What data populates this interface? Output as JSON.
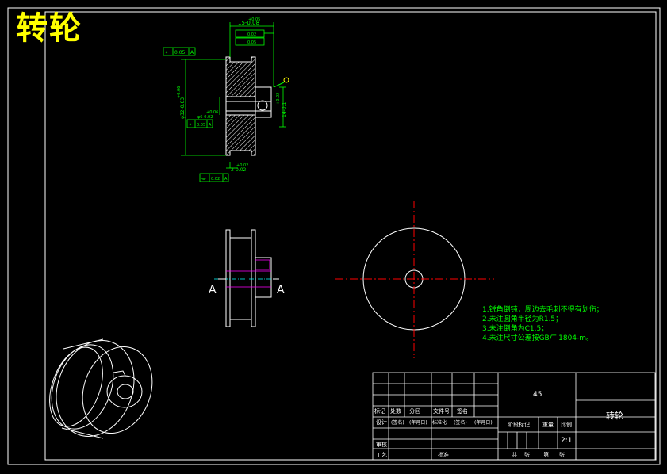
{
  "title": "转轮",
  "colors": {
    "background": "#000000",
    "outline": "#ffffff",
    "title": "#ffff00",
    "dimension": "#00ff00",
    "centerline": "#ff0000",
    "hidden": "#ff00ff",
    "notes": "#00ff00"
  },
  "dimensions": {
    "top_width": "15-0.08",
    "top_width_tol": "+0.05",
    "flatness_tol": "0.05",
    "flatness_datum": "A",
    "diameter": "φ32-0.03",
    "diameter_tol": "+0.06",
    "bore": "φ6-0.02",
    "bore_tol": "+0.06",
    "bore_concentricity": "0.05",
    "bore_datum": "A",
    "height": "14-0.1",
    "height_tol": "+0.02",
    "bottom_small": "2-0.02",
    "bottom_small_tol": "+0.02",
    "symmetry_tol": "0.02",
    "symmetry_datum": "A",
    "perpendicularity": "0.02",
    "parallelism": "0.05"
  },
  "section_label": "A",
  "notes": [
    "1.锐角倒钝，周边去毛刺不得有划伤；",
    "2.未注圆角半径为R1.5；",
    "3.未注倒角为C1.5；",
    "4.未注尺寸公差按GB/T 1804-m。"
  ],
  "title_block": {
    "material": "45",
    "part_name": "转轮",
    "scale": "2:1",
    "labels": {
      "mark": "标记",
      "count": "处数",
      "zone": "分区",
      "doc_no": "文件号",
      "sign": "签名",
      "design": "设计",
      "standardize": "标准化",
      "stage_mark": "阶段标记",
      "weight": "重量",
      "scale": "比例",
      "review": "审核",
      "process": "工艺",
      "approve": "批准",
      "total": "共",
      "sheet": "张",
      "page": "第",
      "page_sheet": "张"
    },
    "placeholders": {
      "sign1": "(签名)",
      "date1": "(年月日)",
      "sign2": "(签名)",
      "date2": "(年月日)"
    }
  }
}
